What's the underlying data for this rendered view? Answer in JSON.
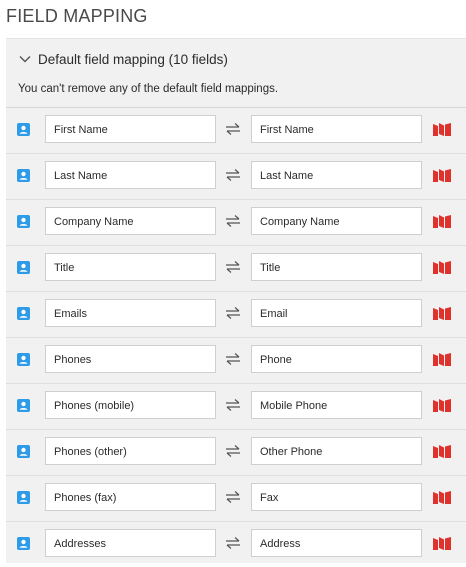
{
  "page": {
    "title": "FIELD MAPPING"
  },
  "panel": {
    "header_label": "Default field mapping (10 fields)",
    "note": "You can't remove any of the default field mappings.",
    "colors": {
      "contact_icon": "#2d9be8",
      "marketo_icon": "#e0322d",
      "panel_bg": "#f1f1f1"
    }
  },
  "icons": {
    "expand": "chevron-down-icon",
    "source": "contact-card-icon",
    "swap": "swap-arrows-icon",
    "target": "marketo-logo-icon"
  },
  "mappings": [
    {
      "source": "First Name",
      "target": "First Name"
    },
    {
      "source": "Last Name",
      "target": "Last Name"
    },
    {
      "source": "Company Name",
      "target": "Company Name"
    },
    {
      "source": "Title",
      "target": "Title"
    },
    {
      "source": "Emails",
      "target": "Email"
    },
    {
      "source": "Phones",
      "target": "Phone"
    },
    {
      "source": "Phones (mobile)",
      "target": "Mobile Phone"
    },
    {
      "source": "Phones (other)",
      "target": "Other Phone"
    },
    {
      "source": "Phones (fax)",
      "target": "Fax"
    },
    {
      "source": "Addresses",
      "target": "Address"
    }
  ]
}
